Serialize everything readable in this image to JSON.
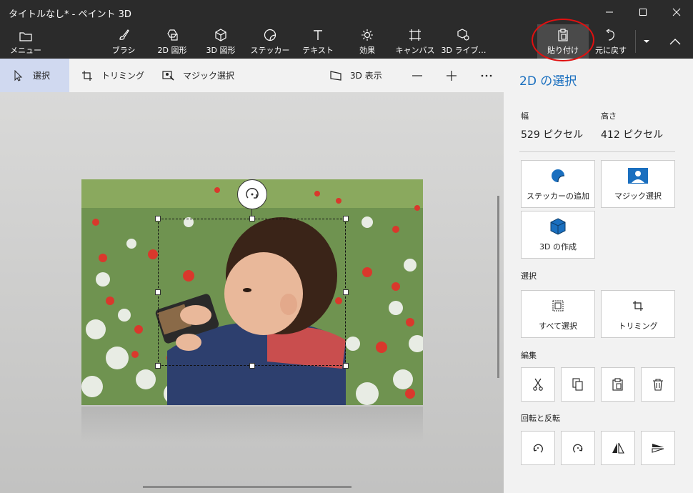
{
  "window": {
    "title": "タイトルなし* - ペイント 3D"
  },
  "ribbon": {
    "menu": "メニュー",
    "tools": [
      "ブラシ",
      "2D 図形",
      "3D 図形",
      "ステッカー",
      "テキスト",
      "効果",
      "キャンバス",
      "3D ライブ…"
    ],
    "paste": "貼り付け",
    "undo": "元に戻す"
  },
  "toolbar": {
    "select": "選択",
    "crop": "トリミング",
    "magic_select": "マジック選択",
    "view3d": "3D 表示"
  },
  "panel": {
    "title": "2D の選択",
    "width_label": "幅",
    "width_value": "529 ピクセル",
    "height_label": "高さ",
    "height_value": "412 ピクセル",
    "add_sticker": "ステッカーの追加",
    "magic_select": "マジック選択",
    "make_3d": "3D の作成",
    "section_select": "選択",
    "select_all": "すべて選択",
    "crop": "トリミング",
    "section_edit": "編集",
    "section_rotate": "回転と反転"
  },
  "colors": {
    "accent": "#1a6fbf",
    "chrome": "#2b2b2b",
    "highlight": "#e01010"
  }
}
